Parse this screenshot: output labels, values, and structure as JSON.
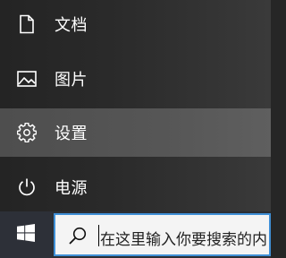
{
  "start_menu": {
    "items": [
      {
        "label": "文档",
        "icon": "document-icon"
      },
      {
        "label": "图片",
        "icon": "pictures-icon"
      },
      {
        "label": "设置",
        "icon": "gear-icon",
        "highlighted": true
      },
      {
        "label": "电源",
        "icon": "power-icon"
      }
    ]
  },
  "taskbar": {
    "start_icon": "windows-logo-icon",
    "search": {
      "icon": "search-icon",
      "placeholder": "在这里输入你要搜索的内"
    }
  },
  "colors": {
    "menu_background": "#2a2a2a",
    "menu_hover": "#565656",
    "taskbar_background": "#2c2f35",
    "search_border": "#3f8fd6",
    "search_background": "#f4f4f4"
  }
}
